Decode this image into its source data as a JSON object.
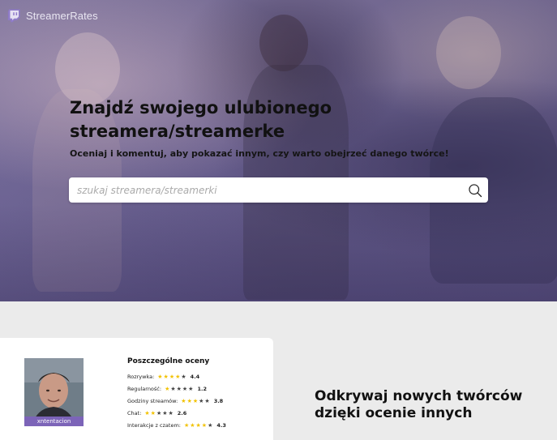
{
  "brand": {
    "name": "StreamerRates",
    "accent": "#7c64b8"
  },
  "hero": {
    "headline": "Znajdź swojego ulubionego streamera/streamerke",
    "subline": "Oceniaj i komentuj, aby pokazać innym, czy warto obejrzeć danego twórce!",
    "search": {
      "placeholder": "szukaj streamera/streamerki",
      "value": "",
      "icon": "search-icon"
    }
  },
  "featured": {
    "streamer_name": "xntentacion",
    "ratings_title": "Poszczególne oceny",
    "ratings": [
      {
        "label": "Rozrywka:",
        "value": "4.4",
        "stars": 4
      },
      {
        "label": "Regularność:",
        "value": "1.2",
        "stars": 1
      },
      {
        "label": "Godziny streamów:",
        "value": "3.8",
        "stars": 3
      },
      {
        "label": "Chat:",
        "value": "2.6",
        "stars": 2
      },
      {
        "label": "Interakcje z czatem:",
        "value": "4.3",
        "stars": 4
      }
    ]
  },
  "discover": {
    "line1": "Odkrywaj nowych twórców",
    "line2": "dzięki ocenie innych"
  },
  "colors": {
    "star_on": "#f2c200",
    "star_off": "#444444",
    "hero_tint": "#6b6192"
  }
}
